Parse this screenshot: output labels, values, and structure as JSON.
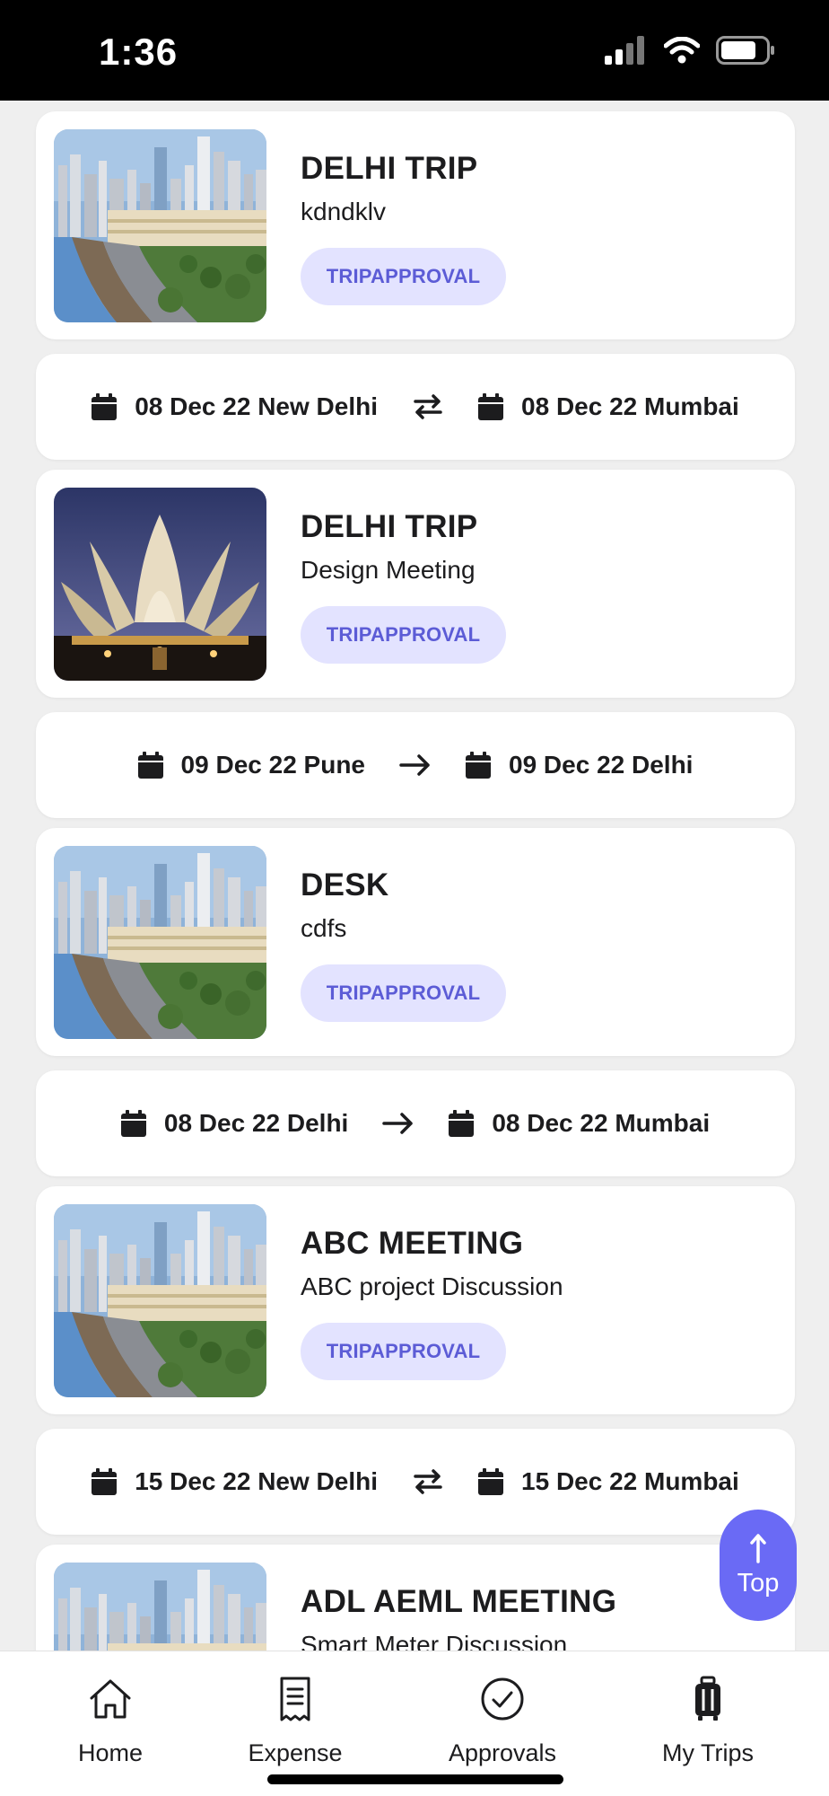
{
  "status_bar": {
    "time": "1:36"
  },
  "trips": [
    {
      "title": "DELHI TRIP",
      "subtitle": "kdndklv",
      "status": "TRIPAPPROVAL",
      "image": "mumbai-skyline",
      "from": "08 Dec 22 New Delhi",
      "to": "08 Dec 22 Mumbai",
      "route_icon": "swap-icon"
    },
    {
      "title": "DELHI TRIP",
      "subtitle": "Design Meeting",
      "status": "TRIPAPPROVAL",
      "image": "lotus-temple",
      "from": "09 Dec 22 Pune",
      "to": "09 Dec 22 Delhi",
      "route_icon": "arrow-right-icon"
    },
    {
      "title": "DESK",
      "subtitle": "cdfs",
      "status": "TRIPAPPROVAL",
      "image": "mumbai-skyline",
      "from": "08 Dec 22 Delhi",
      "to": "08 Dec 22 Mumbai",
      "route_icon": "arrow-right-icon"
    },
    {
      "title": "ABC MEETING",
      "subtitle": "ABC project Discussion",
      "status": "TRIPAPPROVAL",
      "image": "mumbai-skyline",
      "from": "15 Dec 22 New Delhi",
      "to": "15 Dec 22 Mumbai",
      "route_icon": "swap-icon"
    },
    {
      "title": "ADL AEML MEETING",
      "subtitle": "Smart Meter Discussion",
      "image": "mumbai-skyline"
    }
  ],
  "top_button": {
    "label": "Top"
  },
  "nav": [
    {
      "label": "Home",
      "icon": "home-icon"
    },
    {
      "label": "Expense",
      "icon": "receipt-icon"
    },
    {
      "label": "Approvals",
      "icon": "check-circle-icon"
    },
    {
      "label": "My Trips",
      "icon": "luggage-icon"
    }
  ],
  "colors": {
    "accent": "#6a6af5",
    "pill_bg": "#e3e3ff",
    "pill_text": "#5c5cd6",
    "background": "#efefef"
  }
}
